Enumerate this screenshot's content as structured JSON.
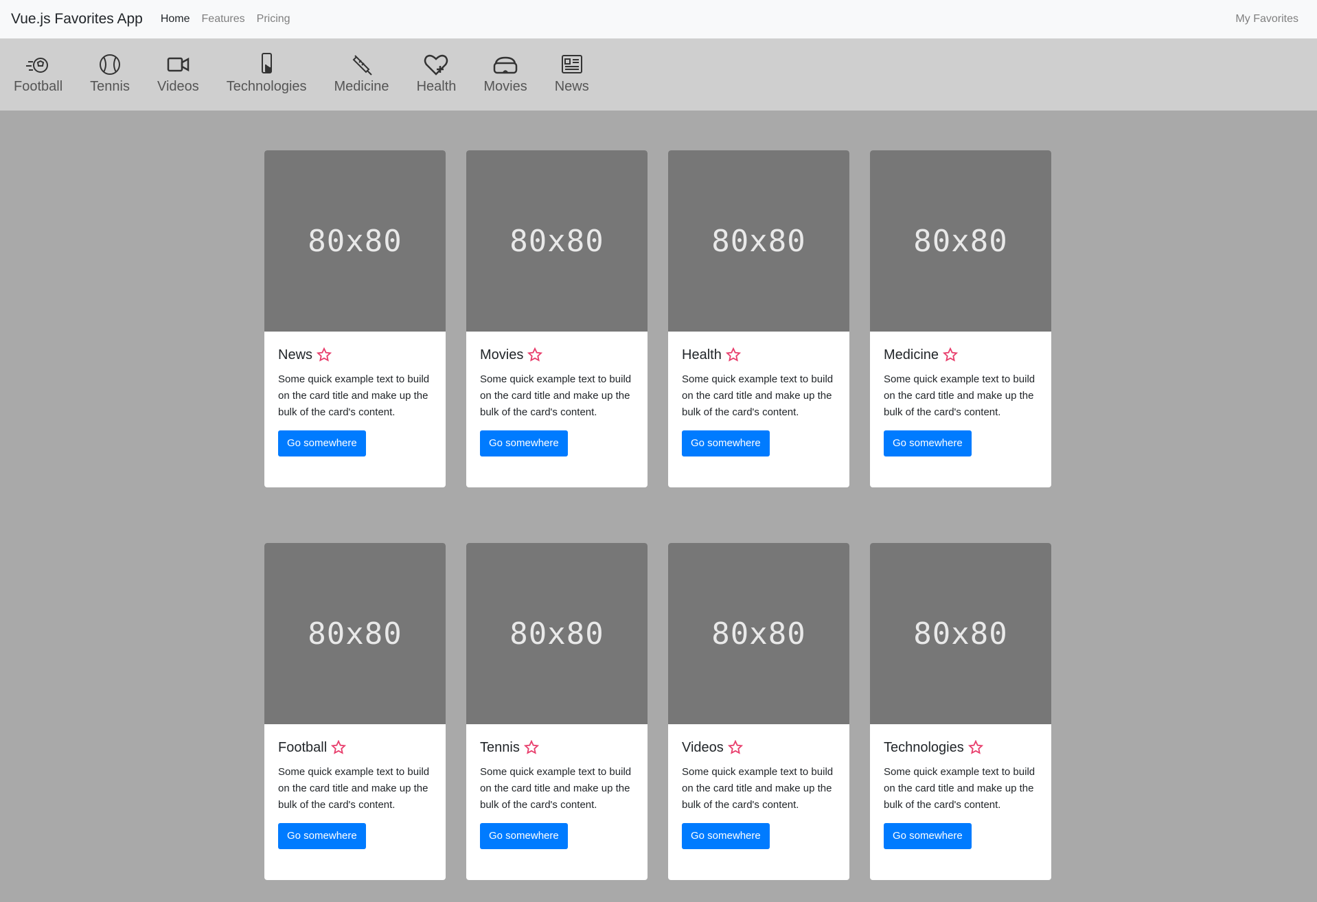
{
  "navbar": {
    "brand": "Vue.js Favorites App",
    "links": [
      "Home",
      "Features",
      "Pricing"
    ],
    "right": "My Favorites"
  },
  "categories": [
    {
      "label": "Football",
      "icon": "football-icon"
    },
    {
      "label": "Tennis",
      "icon": "tennis-icon"
    },
    {
      "label": "Videos",
      "icon": "video-camera-icon"
    },
    {
      "label": "Technologies",
      "icon": "smartphone-icon"
    },
    {
      "label": "Medicine",
      "icon": "syringe-icon"
    },
    {
      "label": "Health",
      "icon": "heart-plus-icon"
    },
    {
      "label": "Movies",
      "icon": "vr-glasses-icon"
    },
    {
      "label": "News",
      "icon": "newspaper-icon"
    }
  ],
  "cards": [
    {
      "title": "News",
      "image": "80x80",
      "text": "Some quick example text to build on the card title and make up the bulk of the card's content.",
      "button": "Go somewhere"
    },
    {
      "title": "Movies",
      "image": "80x80",
      "text": "Some quick example text to build on the card title and make up the bulk of the card's content.",
      "button": "Go somewhere"
    },
    {
      "title": "Health",
      "image": "80x80",
      "text": "Some quick example text to build on the card title and make up the bulk of the card's content.",
      "button": "Go somewhere"
    },
    {
      "title": "Medicine",
      "image": "80x80",
      "text": "Some quick example text to build on the card title and make up the bulk of the card's content.",
      "button": "Go somewhere"
    },
    {
      "title": "Football",
      "image": "80x80",
      "text": "Some quick example text to build on the card title and make up the bulk of the card's content.",
      "button": "Go somewhere"
    },
    {
      "title": "Tennis",
      "image": "80x80",
      "text": "Some quick example text to build on the card title and make up the bulk of the card's content.",
      "button": "Go somewhere"
    },
    {
      "title": "Videos",
      "image": "80x80",
      "text": "Some quick example text to build on the card title and make up the bulk of the card's content.",
      "button": "Go somewhere"
    },
    {
      "title": "Technologies",
      "image": "80x80",
      "text": "Some quick example text to build on the card title and make up the bulk of the card's content.",
      "button": "Go somewhere"
    }
  ],
  "colors": {
    "accent": "#007bff",
    "star": "#e83e6c",
    "page_bg": "#a9a9a9",
    "category_bar": "#cfcfcf",
    "placeholder": "#777777"
  }
}
